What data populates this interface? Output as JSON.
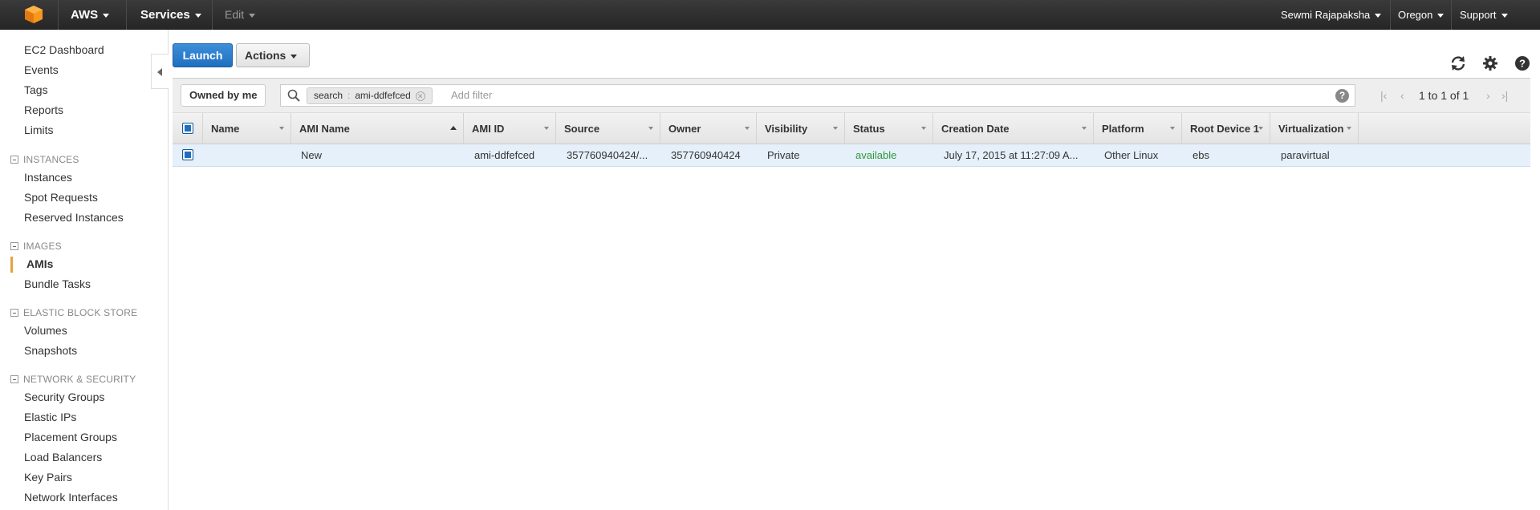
{
  "topbar": {
    "brand": "AWS",
    "services": "Services",
    "edit": "Edit",
    "user": "Sewmi Rajapaksha",
    "region": "Oregon",
    "support": "Support"
  },
  "sidebar": {
    "top_items": [
      "EC2 Dashboard",
      "Events",
      "Tags",
      "Reports",
      "Limits"
    ],
    "instances_head": "INSTANCES",
    "instances": [
      "Instances",
      "Spot Requests",
      "Reserved Instances"
    ],
    "images_head": "IMAGES",
    "images": [
      "AMIs",
      "Bundle Tasks"
    ],
    "ebs_head": "ELASTIC BLOCK STORE",
    "ebs": [
      "Volumes",
      "Snapshots"
    ],
    "network_head": "NETWORK & SECURITY",
    "network": [
      "Security Groups",
      "Elastic IPs",
      "Placement Groups",
      "Load Balancers",
      "Key Pairs",
      "Network Interfaces"
    ]
  },
  "toolbar": {
    "launch": "Launch",
    "actions": "Actions"
  },
  "filter": {
    "owned": "Owned by me",
    "token_key": "search",
    "token_sep": ":",
    "token_value": "ami-ddfefced",
    "add_filter": "Add filter",
    "help": "?",
    "pager": "1 to 1 of 1"
  },
  "table": {
    "columns": [
      "Name",
      "AMI Name",
      "AMI ID",
      "Source",
      "Owner",
      "Visibility",
      "Status",
      "Creation Date",
      "Platform",
      "Root Device 1",
      "Virtualization"
    ],
    "rows": [
      {
        "name": "",
        "ami_name": "New",
        "ami_id": "ami-ddfefced",
        "source": "357760940424/...",
        "owner": "357760940424",
        "visibility": "Private",
        "status": "available",
        "creation_date": "July 17, 2015 at 11:27:09 A...",
        "platform": "Other Linux",
        "root_device": "ebs",
        "virtualization": "paravirtual"
      }
    ]
  },
  "colors": {
    "accent": "#1f6fbf",
    "active_marker": "#e8a13b",
    "status_ok": "#2c9a3a"
  }
}
